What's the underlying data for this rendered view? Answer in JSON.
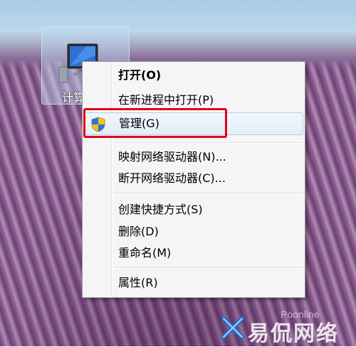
{
  "desktop": {
    "computer_icon_label": "计算机"
  },
  "context_menu": {
    "items": [
      {
        "label": "打开(O)",
        "bold": true
      },
      {
        "label": "在新进程中打开(P)"
      },
      {
        "label": "管理(G)",
        "icon": "uac-shield-icon",
        "highlighted": true
      },
      {
        "label": "映射网络驱动器(N)..."
      },
      {
        "label": "断开网络驱动器(C)..."
      },
      {
        "label": "创建快捷方式(S)"
      },
      {
        "label": "删除(D)"
      },
      {
        "label": "重命名(M)"
      },
      {
        "label": "属性(R)"
      }
    ]
  },
  "watermark": {
    "text": "易侃网络",
    "en": "Poonline"
  },
  "colors": {
    "highlight_box": "#e3001b",
    "menu_background": "#f5f5f5",
    "hover_border": "#aecff7"
  }
}
